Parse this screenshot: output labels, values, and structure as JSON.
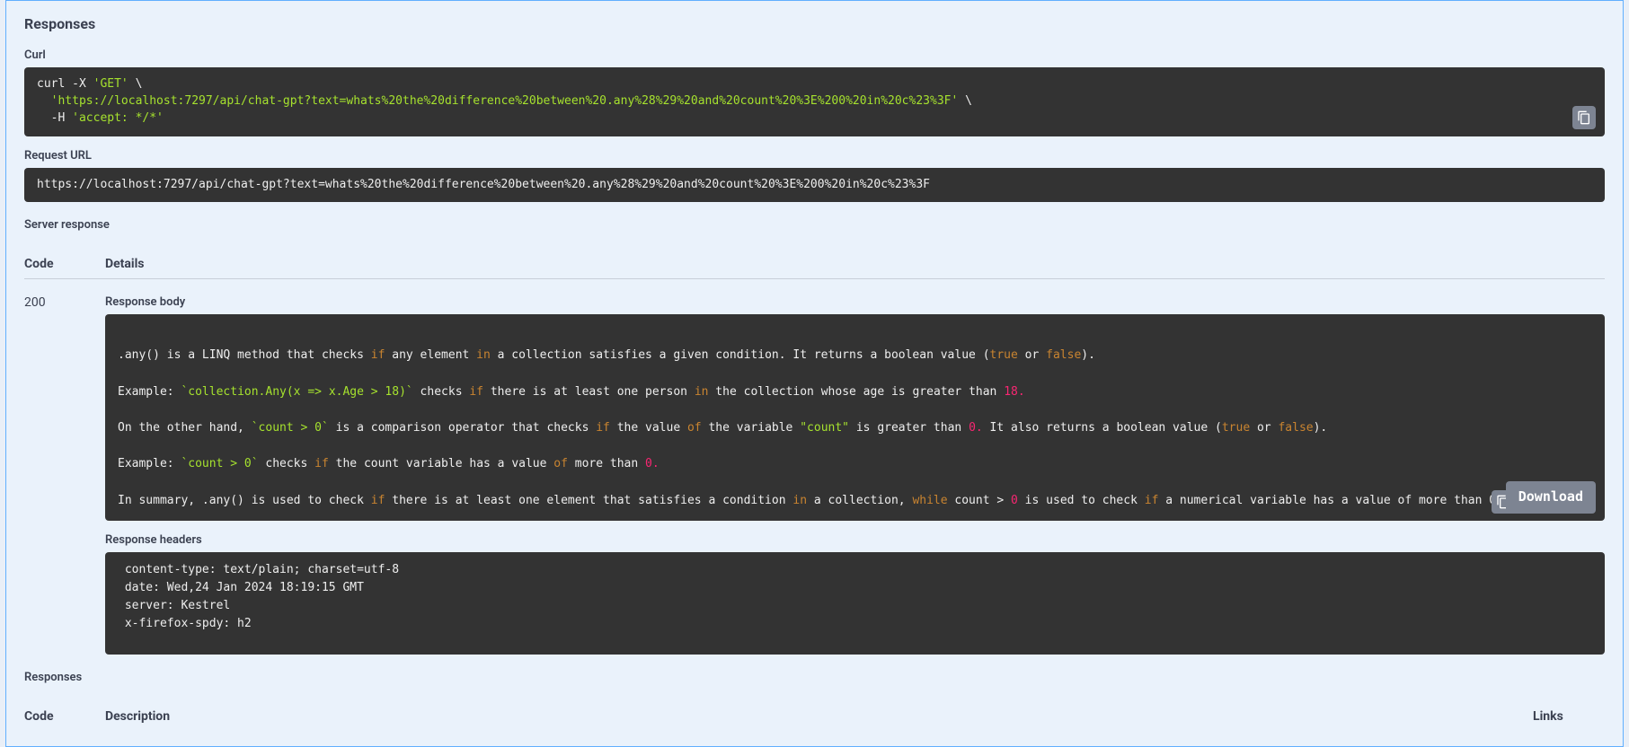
{
  "section": {
    "responses_title": "Responses",
    "curl_label": "Curl",
    "request_url_label": "Request URL",
    "server_response_label": "Server response",
    "codes_header_code": "Code",
    "codes_header_details": "Details",
    "responses_label_bottom": "Responses",
    "bottom_code": "Code",
    "bottom_description": "Description",
    "bottom_links": "Links"
  },
  "curl": {
    "prefix": "curl -X ",
    "method": "'GET'",
    "slash1": " \\",
    "url": "'https://localhost:7297/api/chat-gpt?text=whats%20the%20difference%20between%20.any%28%29%20and%20count%20%3E%200%20in%20c%23%3F'",
    "slash2": " \\",
    "header_flag": "-H ",
    "header_val": "'accept: */*'"
  },
  "request_url": "https://localhost:7297/api/chat-gpt?text=whats%20the%20difference%20between%20.any%28%29%20and%20count%20%3E%200%20in%20c%23%3F",
  "response": {
    "status_code": "200",
    "body_label": "Response body",
    "headers_label": "Response headers",
    "download_label": "Download",
    "body_tokens": {
      "l1a": ".any() is a LINQ method that checks ",
      "l1_if": "if",
      "l1b": " any element ",
      "l1_in": "in",
      "l1c": " a collection satisfies a given condition. It returns a boolean value (",
      "l1_true": "true",
      "l1d": " or ",
      "l1_false": "false",
      "l1e": ").",
      "l2a": "Example: ",
      "l2_code": "`collection.Any(x => x.Age > 18)`",
      "l2b": " checks ",
      "l2_if": "if",
      "l2c": " there is at least one person ",
      "l2_in": "in",
      "l2d": " the collection whose age is greater than ",
      "l2_num": "18.",
      "l3a": "On the other hand, ",
      "l3_code": "`count > 0`",
      "l3b": " is a comparison operator that checks ",
      "l3_if": "if",
      "l3c": " the value ",
      "l3_of": "of",
      "l3d": " the variable ",
      "l3_strlit": "\"count\"",
      "l3e": " is greater than ",
      "l3_num": "0.",
      "l3f": " It also returns a boolean value (",
      "l3_true": "true",
      "l3g": " or ",
      "l3_false": "false",
      "l3h": ").",
      "l4a": "Example: ",
      "l4_code": "`count > 0`",
      "l4b": " checks ",
      "l4_if": "if",
      "l4c": " the count variable has a value ",
      "l4_of": "of",
      "l4d": " more than ",
      "l4_num": "0.",
      "l5a": "In summary, .any() is used to check ",
      "l5_if": "if",
      "l5b": " there is at least one element that satisfies a condition ",
      "l5_in": "in",
      "l5c": " a collection, ",
      "l5_while": "while",
      "l5d": " count > ",
      "l5_num": "0",
      "l5e": " is used to check ",
      "l5_if2": "if",
      "l5f": " a numerical variable has a value of more than 0."
    },
    "headers_text": " content-type: text/plain; charset=utf-8 \n date: Wed,24 Jan 2024 18:19:15 GMT \n server: Kestrel \n x-firefox-spdy: h2 "
  }
}
